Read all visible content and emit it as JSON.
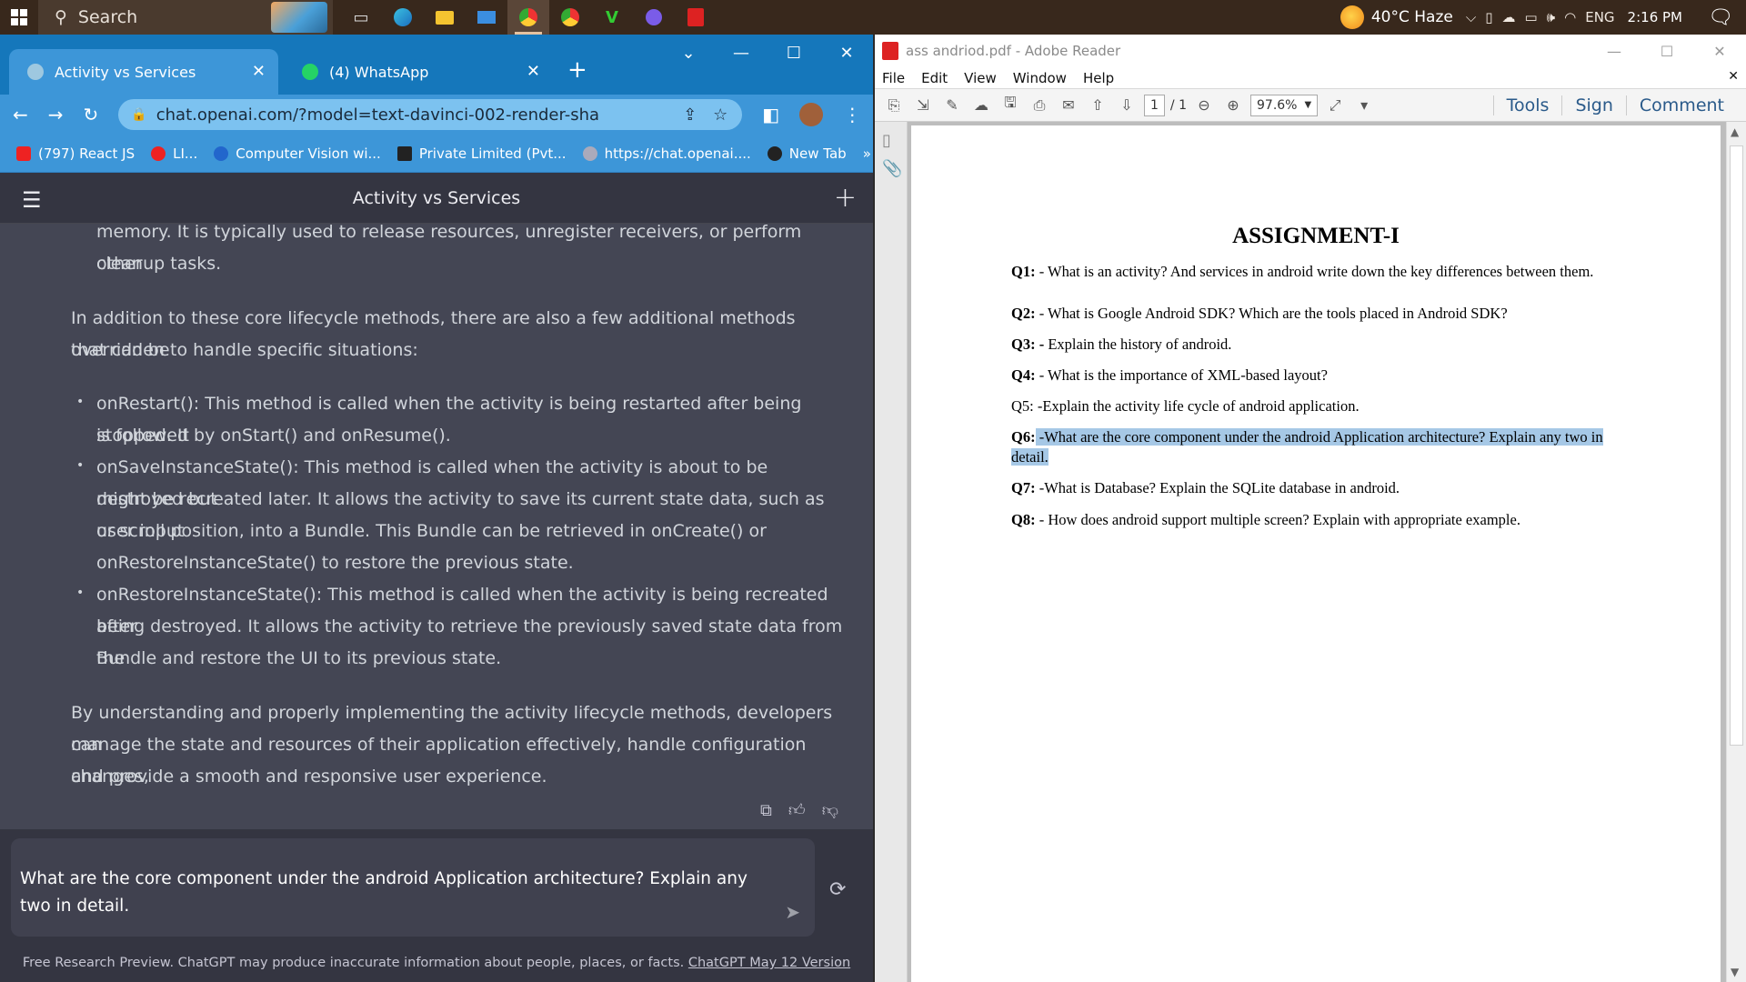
{
  "taskbar": {
    "search_placeholder": "Search",
    "weather": "40°C Haze",
    "language": "ENG",
    "time": "2:16 PM"
  },
  "chrome": {
    "tabs": [
      {
        "label": "Activity vs Services",
        "active": true
      },
      {
        "label": "(4) WhatsApp",
        "active": false
      }
    ],
    "url": "chat.openai.com/?model=text-davinci-002-render-sha",
    "bookmarks": [
      "(797) React JS",
      "LI...",
      "Computer Vision wi...",
      "Private Limited (Pvt...",
      "https://chat.openai....",
      "New Tab"
    ],
    "bookmarks_more": "»"
  },
  "chatgpt": {
    "title": "Activity vs Services",
    "lines": {
      "l1": "memory. It is typically used to release resources, unregister receivers, or perform other",
      "l2": "cleanup tasks.",
      "p1a": "In addition to these core lifecycle methods, there are also a few additional methods that can be",
      "p1b": "overridden to handle specific situations:",
      "b1a": "onRestart(): This method is called when the activity is being restarted after being stopped. It",
      "b1b": "is followed by onStart() and onResume().",
      "b2a": "onSaveInstanceState(): This method is called when the activity is about to be destroyed but",
      "b2b": "might be recreated later. It allows the activity to save its current state data, such as user input",
      "b2c": "or scroll position, into a Bundle. This Bundle can be retrieved in onCreate() or",
      "b2d": "onRestoreInstanceState() to restore the previous state.",
      "b3a": "onRestoreInstanceState(): This method is called when the activity is being recreated after",
      "b3b": "being destroyed. It allows the activity to retrieve the previously saved state data from the",
      "b3c": "Bundle and restore the UI to its previous state.",
      "p2a": "By understanding and properly implementing the activity lifecycle methods, developers can",
      "p2b": "manage the state and resources of their application effectively, handle configuration changes,",
      "p2c": "and provide a smooth and responsive user experience."
    },
    "input_line1": "What are the core component under the android Application architecture? Explain any",
    "input_line2": "two in detail.",
    "footer_text": "Free Research Preview. ChatGPT may produce inaccurate information about people, places, or facts.",
    "footer_link": "ChatGPT May 12 Version"
  },
  "adobe": {
    "window_title": "ass andriod.pdf - Adobe Reader",
    "menu": [
      "File",
      "Edit",
      "View",
      "Window",
      "Help"
    ],
    "page_current": "1",
    "page_total": "/ 1",
    "zoom": "97.6%",
    "right_tools": [
      "Tools",
      "Sign",
      "Comment"
    ],
    "doc": {
      "heading": "ASSIGNMENT-I",
      "questions": [
        {
          "label": "Q1:",
          "text": " - What is an activity? And services in android write down the key differences between them."
        },
        {
          "label": "Q2:",
          "text": " - What is Google Android SDK? Which are the tools placed in Android SDK?"
        },
        {
          "label": "Q3: -",
          "text": " Explain the history of android."
        },
        {
          "label": "Q4:",
          "text": " - What is the importance of XML-based layout?"
        },
        {
          "label": "",
          "text": "Q5: -Explain the activity life cycle of android application."
        },
        {
          "label": "Q6:",
          "text": " -What are the core component under the android Application architecture? Explain any two in detail."
        },
        {
          "label": "Q7:",
          "text": " -What is Database? Explain the SQLite database in android."
        },
        {
          "label": "Q8:",
          "text": " - How does android support multiple screen? Explain with appropriate example."
        }
      ]
    }
  }
}
